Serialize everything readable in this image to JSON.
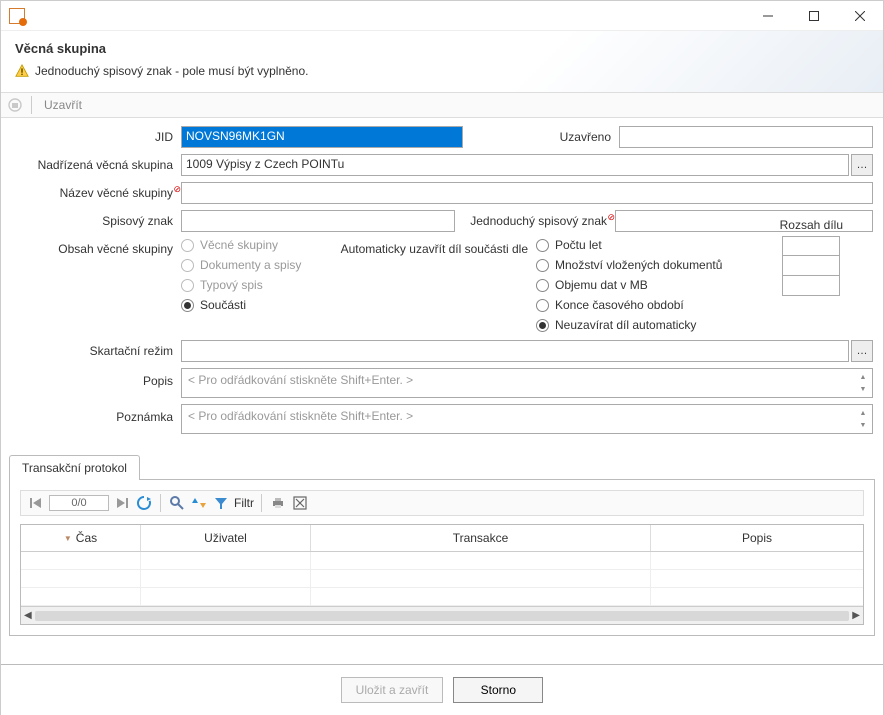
{
  "header": {
    "title": "Věcná skupina",
    "warning": "Jednoduchý spisový znak - pole musí být vyplněno."
  },
  "toolbar": {
    "close": "Uzavřít"
  },
  "form": {
    "jid_label": "JID",
    "jid_value": "NOVSN96MK1GN",
    "closed_label": "Uzavřeno",
    "closed_value": "",
    "parent_label": "Nadřízená věcná skupina",
    "parent_value": "1009 Výpisy z Czech POINTu",
    "name_label": "Název věcné skupiny",
    "name_value": "",
    "filesign_label": "Spisový znak",
    "filesign_value": "",
    "simple_sign_label": "Jednoduchý spisový znak",
    "simple_sign_value": "",
    "content_label": "Obsah věcné skupiny",
    "content_opts": {
      "groups": "Věcné skupiny",
      "docs": "Dokumenty a spisy",
      "typical": "Typový spis",
      "parts": "Součásti"
    },
    "autoclose_label": "Automaticky uzavřít díl součásti dle",
    "autoclose_opts": {
      "years": "Počtu let",
      "count": "Množství vložených dokumentů",
      "volume": "Objemu dat v MB",
      "period": "Konce časového období",
      "never": "Neuzavírat díl automaticky"
    },
    "range_label": "Rozsah dílu",
    "shred_label": "Skartační režim",
    "shred_value": "",
    "desc_label": "Popis",
    "desc_placeholder": "< Pro odřádkování stiskněte Shift+Enter. >",
    "note_label": "Poznámka",
    "note_placeholder": "< Pro odřádkování stiskněte Shift+Enter. >"
  },
  "tabs": {
    "protocol": "Transakční protokol"
  },
  "grid": {
    "page": "0/0",
    "filter": "Filtr",
    "cols": {
      "time": "Čas",
      "user": "Uživatel",
      "tx": "Transakce",
      "desc": "Popis"
    }
  },
  "footer": {
    "save": "Uložit a zavřít",
    "cancel": "Storno"
  }
}
